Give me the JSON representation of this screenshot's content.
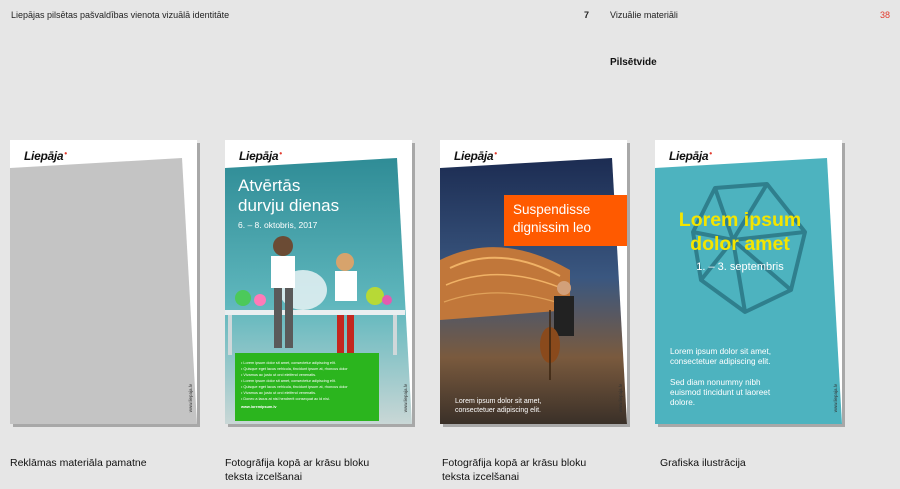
{
  "header": {
    "left_title": "Liepājas pilsētas pašvaldības vienota vizuālā identitāte",
    "page_left": "7",
    "section": "Vizuālie materiāli",
    "page_right": "38"
  },
  "section_title": "Pilsētvide",
  "logo_text": "Liepāja",
  "logo_mark": "•",
  "poster_url": "www.liepaja.lv",
  "posters": {
    "p2": {
      "title_line1": "Atvērtās",
      "title_line2": "durvju dienas",
      "date": "6. – 8. oktobris, 2017",
      "bullets": [
        "• Lorem ipsum dolor sit amet, consectetur adipiscing elit.",
        "• Quisque eget lacus vehicula, tincidunt ipsum at, rhoncus dolor",
        "• Vivamus ac justo ut orci eleifend venenatis.",
        "• Lorem ipsum dolor sit amet, consectetur adipiscing elit.",
        "• Quisque eget lacus vehicula, tincidunt ipsum at, rhoncus dolor",
        "• Vivamus ac justo ut orci eleifend venenatis.",
        "• Donec a lacus at nisl hendrerit consequat ac id nisi."
      ],
      "green_url": "www.loremipsum.lv"
    },
    "p3": {
      "headline_line1": "Suspendisse",
      "headline_line2": "dignissim leo",
      "body_line1": "Lorem ipsum dolor sit amet,",
      "body_line2": "consectetuer adipiscing elit."
    },
    "p4": {
      "title_line1": "Lorem ipsum",
      "title_line2": "dolor amet",
      "date": "1. – 3. septembris",
      "body1_line1": "Lorem ipsum dolor sit amet,",
      "body1_line2": "consectetuer adipiscing elit.",
      "body2_line1": "Sed diam nonummy nibh",
      "body2_line2": "euismod tincidunt ut laoreet",
      "body2_line3": "dolore."
    }
  },
  "captions": {
    "c1": "Reklāmas materiāla pamatne",
    "c2_line1": "Fotogrāfija kopā ar krāsu bloku",
    "c2_line2": "teksta izcelšanai",
    "c3_line1": "Fotogrāfija kopā ar krāsu bloku",
    "c3_line2": "teksta izcelšanai",
    "c4": "Grafiska ilustrācija"
  },
  "colors": {
    "accent_red": "#e23b2e",
    "grey_block": "#c4c4c4",
    "teal": "#4db3bf",
    "green": "#2bb51e",
    "orange": "#ff5a00",
    "yellow": "#f4e500"
  }
}
